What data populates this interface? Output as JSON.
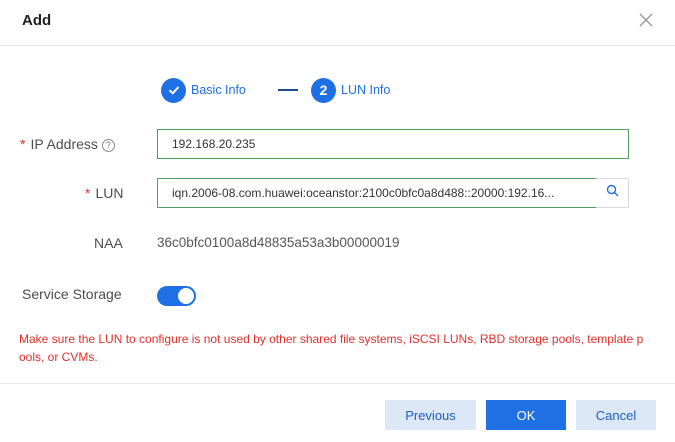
{
  "dialog": {
    "title": "Add",
    "close_icon": "close-icon"
  },
  "steps": [
    {
      "label": "Basic Info",
      "state": "done",
      "icon": "check-icon"
    },
    {
      "number": "2",
      "label": "LUN Info",
      "state": "active"
    }
  ],
  "form": {
    "ip_address": {
      "label": "IP Address",
      "required_mark": "*",
      "help_icon": "?",
      "value": "192.168.20.235"
    },
    "lun": {
      "label": "LUN",
      "required_mark": "*",
      "value": "iqn.2006-08.com.huawei:oceanstor:2100c0bfc0a8d488::20000:192.16...",
      "search_icon": "search-icon"
    },
    "naa": {
      "label": "NAA",
      "value": "36c0bfc0100a8d48835a53a3b00000019"
    },
    "service_storage": {
      "label": "Service Storage",
      "enabled": true
    }
  },
  "warning": "Make sure the LUN to configure is not used by other shared file systems, iSCSI LUNs, RBD storage pools, template pools, or CVMs.",
  "buttons": {
    "previous": "Previous",
    "ok": "OK",
    "cancel": "Cancel"
  },
  "colors": {
    "primary": "#1f6fe5",
    "secondary_bg": "#dde8f7",
    "warning": "#e0302b",
    "input_border": "#56a05f"
  }
}
